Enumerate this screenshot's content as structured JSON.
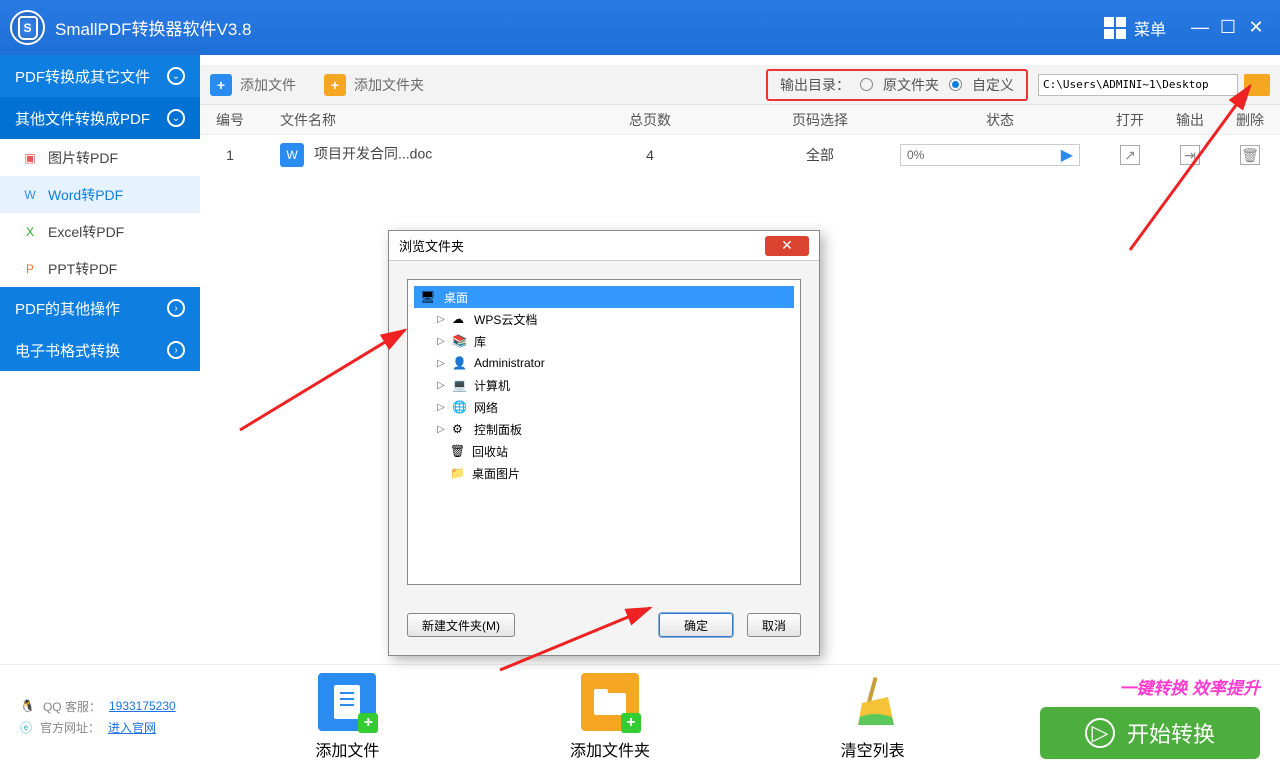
{
  "title": "SmallPDF转换器软件V3.8",
  "menu": "菜单",
  "sidebar": {
    "cat1": "PDF转换成其它文件",
    "cat2": "其他文件转换成PDF",
    "cat3": "PDF的其他操作",
    "cat4": "电子书格式转换",
    "items": [
      "图片转PDF",
      "Word转PDF",
      "Excel转PDF",
      "PPT转PDF"
    ]
  },
  "toolbar": {
    "add_file": "添加文件",
    "add_folder": "添加文件夹",
    "out_label": "输出目录：",
    "out_orig": "原文件夹",
    "out_custom": "自定义",
    "path": "C:\\Users\\ADMINI~1\\Desktop"
  },
  "thead": {
    "num": "编号",
    "name": "文件名称",
    "pages": "总页数",
    "sel": "页码选择",
    "status": "状态",
    "open": "打开",
    "out": "输出",
    "del": "删除"
  },
  "row": {
    "num": "1",
    "name": "项目开发合同...doc",
    "pages": "4",
    "sel": "全部",
    "status": "0%"
  },
  "bottom": {
    "qq_lbl": "QQ 客服：",
    "qq": "1933175230",
    "site_lbl": "官方网址：",
    "site": "进入官网",
    "add_file": "添加文件",
    "add_folder": "添加文件夹",
    "clear": "清空列表",
    "slogan": "一键转换  效率提升",
    "start": "开始转换"
  },
  "dialog": {
    "title": "浏览文件夹",
    "tree": [
      "桌面",
      "WPS云文档",
      "库",
      "Administrator",
      "计算机",
      "网络",
      "控制面板",
      "回收站",
      "桌面图片"
    ],
    "new_folder": "新建文件夹(M)",
    "ok": "确定",
    "cancel": "取消"
  }
}
